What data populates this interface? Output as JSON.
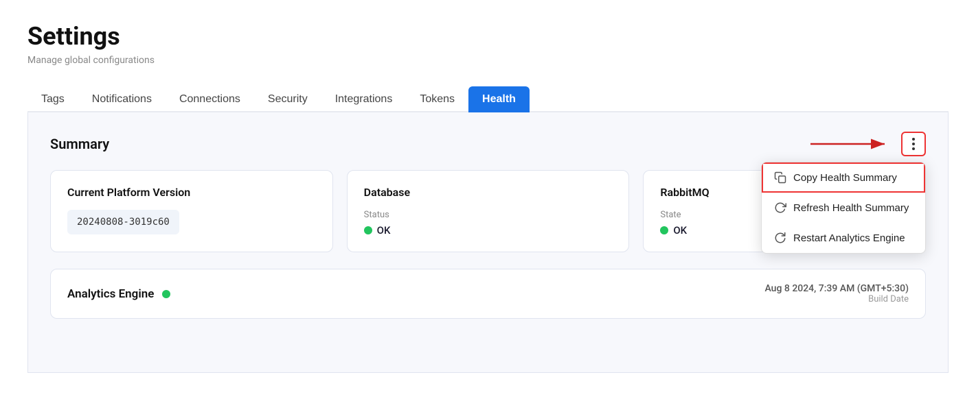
{
  "page": {
    "title": "Settings",
    "subtitle": "Manage global configurations"
  },
  "tabs": [
    {
      "id": "tags",
      "label": "Tags",
      "active": false
    },
    {
      "id": "notifications",
      "label": "Notifications",
      "active": false
    },
    {
      "id": "connections",
      "label": "Connections",
      "active": false
    },
    {
      "id": "security",
      "label": "Security",
      "active": false
    },
    {
      "id": "integrations",
      "label": "Integrations",
      "active": false
    },
    {
      "id": "tokens",
      "label": "Tokens",
      "active": false
    },
    {
      "id": "health",
      "label": "Health",
      "active": true
    }
  ],
  "summary": {
    "title": "Summary",
    "cards": [
      {
        "id": "platform-version",
        "title": "Current Platform Version",
        "type": "version",
        "version": "20240808-3019c60"
      },
      {
        "id": "database",
        "title": "Database",
        "type": "status",
        "status_label": "Status",
        "status_value": "OK"
      },
      {
        "id": "rabbitmq",
        "title": "RabbitMQ",
        "type": "status",
        "status_label": "State",
        "status_value": "OK"
      }
    ]
  },
  "dropdown": {
    "items": [
      {
        "id": "copy-health",
        "label": "Copy Health Summary",
        "icon": "copy",
        "highlighted": true
      },
      {
        "id": "refresh-health",
        "label": "Refresh Health Summary",
        "icon": "refresh"
      },
      {
        "id": "restart-engine",
        "label": "Restart Analytics Engine",
        "icon": "restart"
      }
    ]
  },
  "analytics": {
    "title": "Analytics Engine",
    "date": "Aug 8 2024, 7:39 AM (GMT+5:30)",
    "date_label": "Build Date"
  }
}
